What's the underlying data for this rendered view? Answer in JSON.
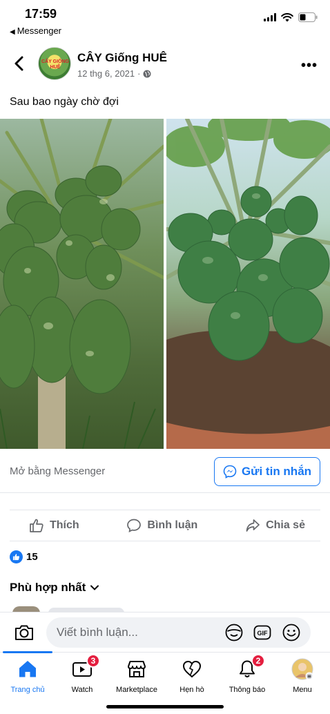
{
  "status_bar": {
    "time": "17:59",
    "back_app": "Messenger"
  },
  "post": {
    "page_name": "CÂY Giống HUÊ",
    "date": "12 thg 6, 2021",
    "date_separator": "·",
    "avatar_text": "CÂY GIỐNG HUÊ",
    "caption": "Sau bao ngày chờ đợi"
  },
  "messenger_row": {
    "open_label": "Mở bằng Messenger",
    "send_label": "Gửi tin nhắn"
  },
  "actions": {
    "like": "Thích",
    "comment": "Bình luận",
    "share": "Chia sẻ"
  },
  "reactions": {
    "count": "15"
  },
  "comments": {
    "sort_label": "Phù hợp nhất"
  },
  "composer": {
    "placeholder": "Viết bình luận..."
  },
  "bottom_nav": [
    {
      "label": "Trang chủ",
      "active": true
    },
    {
      "label": "Watch",
      "badge": "3"
    },
    {
      "label": "Marketplace"
    },
    {
      "label": "Hẹn hò"
    },
    {
      "label": "Thông báo",
      "badge": "2"
    },
    {
      "label": "Menu"
    }
  ],
  "colors": {
    "accent": "#1877f2",
    "badge": "#e41e3f",
    "secondary_text": "#65676b"
  }
}
